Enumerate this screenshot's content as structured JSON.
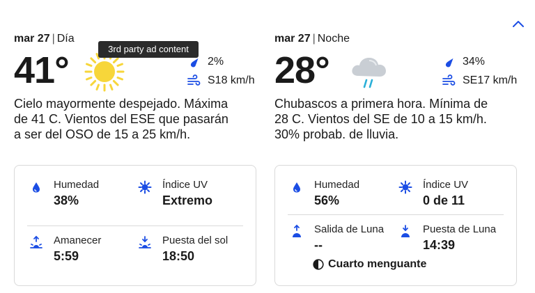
{
  "tooltip": "3rd party ad content",
  "day": {
    "date": "mar 27",
    "period": "Día",
    "temp": "41°",
    "precip": "2%",
    "wind": "S18 km/h",
    "description": "Cielo mayormente despejado. Máxima de 41 C. Vientos del ESE que pasarán a ser del OSO de 15 a 25 km/h.",
    "icon": "sun-icon",
    "details": {
      "humidity_label": "Humedad",
      "humidity_value": "38%",
      "uv_label": "Índice UV",
      "uv_value": "Extremo",
      "sunrise_label": "Amanecer",
      "sunrise_value": "5:59",
      "sunset_label": "Puesta del sol",
      "sunset_value": "18:50"
    }
  },
  "night": {
    "date": "mar 27",
    "period": "Noche",
    "temp": "28°",
    "precip": "34%",
    "wind": "SE17 km/h",
    "description": "Chubascos a primera hora. Mínima de 28 C. Vientos del SE de 10 a 15 km/h. 30% probab. de lluvia.",
    "icon": "cloud-rain-icon",
    "details": {
      "humidity_label": "Humedad",
      "humidity_value": "56%",
      "uv_label": "Índice UV",
      "uv_value": "0 de 11",
      "moonrise_label": "Salida de Luna",
      "moonrise_value": "--",
      "moonset_label": "Puesta de Luna",
      "moonset_value": "14:39",
      "moon_phase": "Cuarto menguante"
    }
  },
  "colors": {
    "accent": "#1b4de4",
    "sun": "#f7d63a",
    "text": "#1a1a1a",
    "border": "#d9d9d9"
  }
}
